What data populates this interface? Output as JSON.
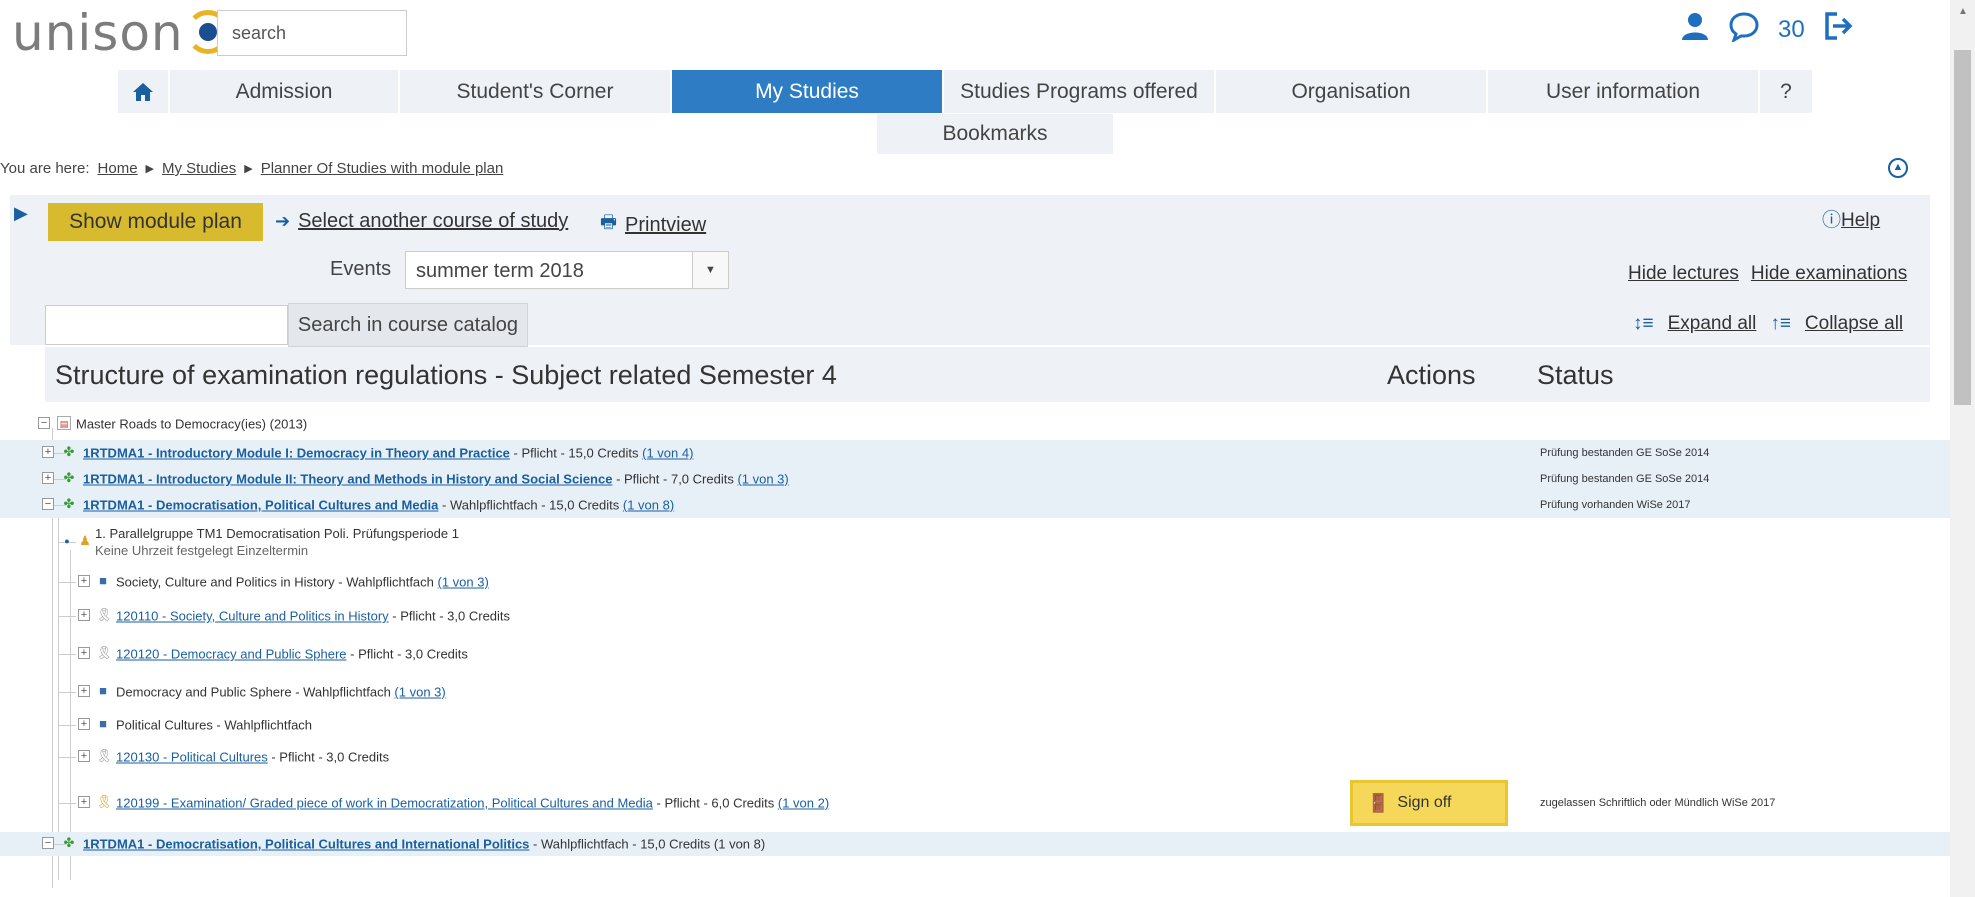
{
  "header": {
    "logo_text": "unison",
    "search_placeholder": "search",
    "notification_count": "30",
    "icons": [
      "user-icon",
      "chat-icon",
      "logout-icon"
    ]
  },
  "nav": {
    "home_icon": "home-icon",
    "items": [
      "Admission",
      "Student's Corner",
      "My Studies",
      "Studies Programs offered",
      "Organisation",
      "User information",
      "?"
    ],
    "active": "My Studies",
    "bookmarks": "Bookmarks"
  },
  "breadcrumb": {
    "prefix": "You are here:",
    "items": [
      "Home",
      "My Studies",
      "Planner Of Studies with module plan"
    ]
  },
  "toolbar": {
    "show_module_plan": "Show module plan",
    "select_course": "Select another course of study",
    "printview": "Printview",
    "help": "Help",
    "events_label": "Events",
    "events_value": "summer term 2018",
    "hide_lectures": "Hide lectures",
    "hide_examinations": "Hide examinations",
    "search_catalog": "Search in course catalog",
    "expand_all": "Expand all",
    "collapse_all": "Collapse all"
  },
  "table": {
    "col_structure": "Structure of examination regulations - Subject related Semester 4",
    "col_actions": "Actions",
    "col_status": "Status"
  },
  "tree": {
    "root": "Master Roads to Democracy(ies) (2013)",
    "rows": [
      {
        "link": "1RTDMA1 - Introductory Module I: Democracy in Theory and Practice",
        "text": " - Pflicht - 15,0 Credits ",
        "count": "(1 von 4)",
        "status": "Prüfung bestanden GE  SoSe 2014"
      },
      {
        "link": "1RTDMA1 - Introductory Module II: Theory and Methods in History and Social Science",
        "text": " - Pflicht - 7,0 Credits ",
        "count": "(1 von 3)",
        "status": "Prüfung bestanden GE  SoSe 2014"
      },
      {
        "link": "1RTDMA1 - Democratisation, Political Cultures and Media",
        "text": " - Wahlpflichtfach - 15,0 Credits ",
        "count": "(1 von 8)",
        "status": "Prüfung vorhanden  WiSe 2017"
      },
      {
        "line1": "1. Parallelgruppe TM1 Democratisation Poli. Prüfungsperiode 1",
        "line2": "Keine Uhrzeit festgelegt Einzeltermin"
      },
      {
        "text": "Society, Culture and Politics in History - Wahlpflichtfach ",
        "count": "(1 von 3)"
      },
      {
        "link": "120110 - Society, Culture and Politics in History",
        "text": " - Pflicht - 3,0 Credits"
      },
      {
        "link": "120120 - Democracy and Public Sphere",
        "text": " - Pflicht - 3,0 Credits"
      },
      {
        "text": "Democracy and Public Sphere - Wahlpflichtfach ",
        "count": "(1 von 3)"
      },
      {
        "text": "Political Cultures - Wahlpflichtfach"
      },
      {
        "link": "120130 - Political Cultures",
        "text": " - Pflicht - 3,0 Credits"
      },
      {
        "link": "120199 - Examination/ Graded piece of work in Democratization, Political Cultures and Media",
        "text": " - Pflicht - 6,0 Credits ",
        "count": "(1 von 2)",
        "action": "Sign off",
        "status": "zugelassen Schriftlich oder Mündlich  WiSe 2017"
      },
      {
        "link": "1RTDMA1 - Democratisation, Political Cultures and International Politics",
        "text": " - Wahlpflichtfach - 15,0 Credits ",
        "count": "(1 von 8)"
      }
    ]
  }
}
